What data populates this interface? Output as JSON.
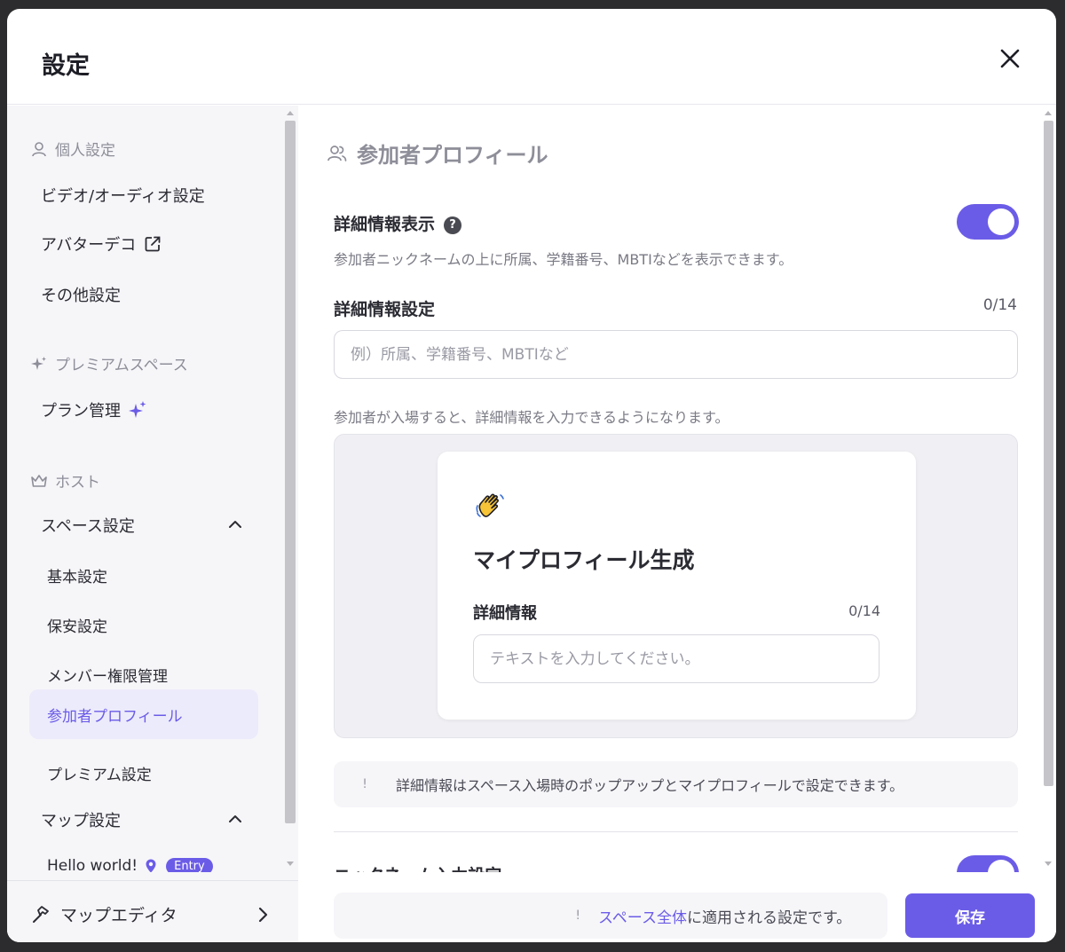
{
  "modal": {
    "title": "設定"
  },
  "sidebar": {
    "personal_header": "個人設定",
    "personal_items": [
      "ビデオ/オーディオ設定",
      "アバターデコ",
      "その他設定"
    ],
    "premium_header": "プレミアムスペース",
    "premium_items": [
      "プラン管理"
    ],
    "host_header": "ホスト",
    "space_settings": "スペース設定",
    "space_sub": [
      "基本設定",
      "保安設定",
      "メンバー権限管理",
      "参加者プロフィール",
      "プレミアム設定"
    ],
    "map_settings": "マップ設定",
    "map_item": "Hello world!",
    "map_badge": "Entry",
    "footer_label": "マップエディタ"
  },
  "main": {
    "title": "参加者プロフィール",
    "detail_display_label": "詳細情報表示",
    "detail_display_help": "?",
    "detail_display_desc": "参加者ニックネームの上に所属、学籍番号、MBTIなどを表示できます。",
    "detail_display_enabled": true,
    "detail_setting_label": "詳細情報設定",
    "detail_setting_counter": "0/14",
    "detail_setting_placeholder": "例）所属、学籍番号、MBTIなど",
    "detail_setting_desc": "参加者が入場すると、詳細情報を入力できるようになります。",
    "preview": {
      "title": "マイプロフィール生成",
      "label": "詳細情報",
      "counter": "0/14",
      "placeholder": "テキストを入力してください。"
    },
    "notice_icon": "!",
    "notice": "詳細情報はスペース入場時のポップアップとマイプロフィールで設定できます。",
    "nickname_label": "ニックネーム入力設定",
    "nickname_enabled": true
  },
  "footer": {
    "note_icon": "!",
    "note_link": "スペース全体",
    "note_text": "に適用される設定です。",
    "save_label": "保存"
  },
  "colors": {
    "accent": "#6b5ce7",
    "accent_bg": "#ecebfb"
  }
}
